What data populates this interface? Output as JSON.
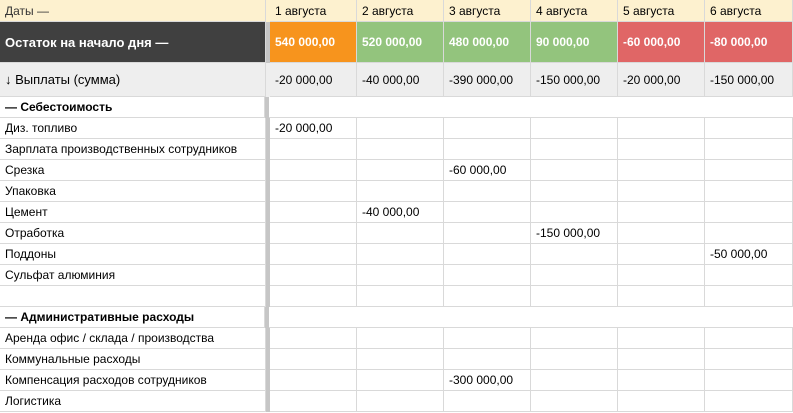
{
  "header": {
    "label": "Даты —",
    "dates": [
      "1 августа",
      "2 августа",
      "3 августа",
      "4 августа",
      "5 августа",
      "6 августа"
    ]
  },
  "balance": {
    "label": "Остаток на начало дня —",
    "values": [
      "540 000,00",
      "520 000,00",
      "480 000,00",
      "90 000,00",
      "-60 000,00",
      "-80 000,00"
    ],
    "colors": [
      "#f7941d",
      "#93c47d",
      "#93c47d",
      "#93c47d",
      "#e06666",
      "#e06666"
    ]
  },
  "payments": {
    "label": "↓ Выплаты (сумма)",
    "values": [
      "-20 000,00",
      "-40 000,00",
      "-390 000,00",
      "-150 000,00",
      "-20 000,00",
      "-150 000,00"
    ]
  },
  "section_cost": {
    "label": "— Себестоимость",
    "rows": [
      {
        "label": "Диз. топливо",
        "values": [
          "-20 000,00",
          "",
          "",
          "",
          "",
          ""
        ]
      },
      {
        "label": "Зарплата производственных сотрудников",
        "values": [
          "",
          "",
          "",
          "",
          "",
          ""
        ]
      },
      {
        "label": "Срезка",
        "values": [
          "",
          "",
          "-60 000,00",
          "",
          "",
          ""
        ]
      },
      {
        "label": "Упаковка",
        "values": [
          "",
          "",
          "",
          "",
          "",
          ""
        ]
      },
      {
        "label": "Цемент",
        "values": [
          "",
          "-40 000,00",
          "",
          "",
          "",
          ""
        ]
      },
      {
        "label": "Отработка",
        "values": [
          "",
          "",
          "",
          "-150 000,00",
          "",
          ""
        ]
      },
      {
        "label": "Поддоны",
        "values": [
          "",
          "",
          "",
          "",
          "",
          "-50 000,00"
        ]
      },
      {
        "label": "Сульфат алюминия",
        "values": [
          "",
          "",
          "",
          "",
          "",
          ""
        ]
      },
      {
        "label": "",
        "values": [
          "",
          "",
          "",
          "",
          "",
          ""
        ]
      }
    ]
  },
  "section_admin": {
    "label": "— Административные расходы",
    "rows": [
      {
        "label": "Аренда офис / склада / производства",
        "values": [
          "",
          "",
          "",
          "",
          "",
          ""
        ]
      },
      {
        "label": "Коммунальные расходы",
        "values": [
          "",
          "",
          "",
          "",
          "",
          ""
        ]
      },
      {
        "label": "Компенсация расходов сотрудников",
        "values": [
          "",
          "",
          "-300 000,00",
          "",
          "",
          ""
        ]
      },
      {
        "label": "Логистика",
        "values": [
          "",
          "",
          "",
          "",
          "",
          ""
        ]
      }
    ]
  }
}
